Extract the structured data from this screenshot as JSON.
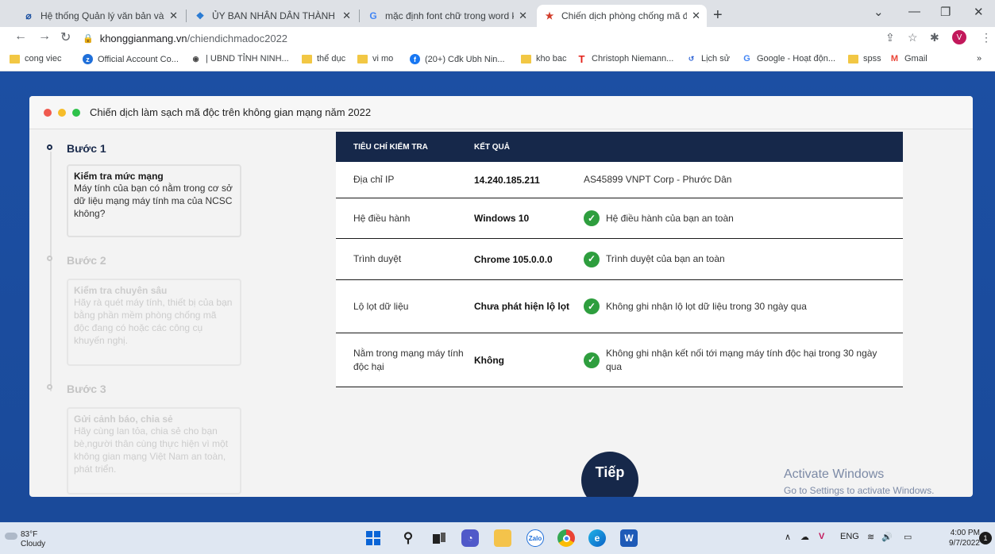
{
  "browser": {
    "tabs": [
      {
        "title": "Hệ thống Quản lý văn bản và Điề",
        "favicon": "doc-icon"
      },
      {
        "title": "ỦY BAN NHÂN DÂN THÀNH PHC",
        "favicon": "emblem-icon"
      },
      {
        "title": "mặc định font chữ trong word kh",
        "favicon": "google-icon"
      },
      {
        "title": "Chiến dịch phòng chống mã độc",
        "favicon": "star-icon"
      }
    ],
    "url_host": "khonggianmang.vn",
    "url_path": "/chiendichmadoc2022",
    "profile_initial": "V",
    "bookmarks": [
      "cong viec",
      "Official Account Co...",
      "| UBND TỈNH NINH...",
      "thể dục",
      "vi mo",
      "(20+) Cđk Ubh Nin...",
      "kho bac",
      "Christoph Niemann...",
      "Lịch sử",
      "Google - Hoạt độn...",
      "spss",
      "Gmail"
    ]
  },
  "page": {
    "card_title": "Chiến dịch làm sạch mã độc trên không gian mạng năm 2022",
    "steps": [
      {
        "title": "Bước 1",
        "heading": "Kiểm tra mức mạng",
        "text": "Máy tính của bạn có nằm trong cơ sở dữ liệu mạng máy tính ma của NCSC không?"
      },
      {
        "title": "Bước 2",
        "heading": "Kiểm tra chuyên sâu",
        "text": "Hãy rà quét máy tính, thiết bị của bạn bằng phần mềm phòng chống mã độc đang có hoặc các công cụ khuyến nghị."
      },
      {
        "title": "Bước 3",
        "heading": "Gửi cảnh báo, chia sẻ",
        "text": "Hãy cùng lan tỏa, chia sẻ cho bạn bè,người thân cùng thực hiện vì một không gian mạng Việt Nam an toàn, phát triển."
      }
    ],
    "table": {
      "headers": [
        "TIÊU CHÍ KIỂM TRA",
        "KẾT QUẢ"
      ],
      "rows": [
        {
          "criterion": "Địa chỉ IP",
          "value": "14.240.185.211",
          "result": "AS45899 VNPT Corp - Phước Dân",
          "ok": false
        },
        {
          "criterion": "Hệ điều hành",
          "value": "Windows 10",
          "result": "Hệ điều hành của bạn an toàn",
          "ok": true
        },
        {
          "criterion": "Trình duyệt",
          "value": "Chrome 105.0.0.0",
          "result": "Trình duyệt của bạn an toàn",
          "ok": true
        },
        {
          "criterion": "Lộ lọt dữ liệu",
          "value": "Chưa phát hiện lộ lọt",
          "result": "Không ghi nhận lộ lọt dữ liệu trong 30 ngày qua",
          "ok": true
        },
        {
          "criterion": "Nằm trong mạng máy tính độc hại",
          "value": "Không",
          "result": "Không ghi nhận kết nối tới mạng máy tính độc hại trong 30 ngày qua",
          "ok": true
        }
      ]
    },
    "next_label": "Tiếp",
    "watermark_line1": "Activate Windows",
    "watermark_line2": "Go to Settings to activate Windows."
  },
  "taskbar": {
    "temp": "83°F",
    "weather": "Cloudy",
    "lang": "ENG",
    "time": "4:00 PM",
    "date": "9/7/2022",
    "notifications": "1"
  },
  "colors": {
    "page_bg": "#1c4fa3",
    "table_header": "#16284a",
    "check": "#2e9e3e",
    "dot_red": "#f05a4f",
    "dot_yellow": "#f6bd2a",
    "dot_green": "#2ec24a"
  }
}
